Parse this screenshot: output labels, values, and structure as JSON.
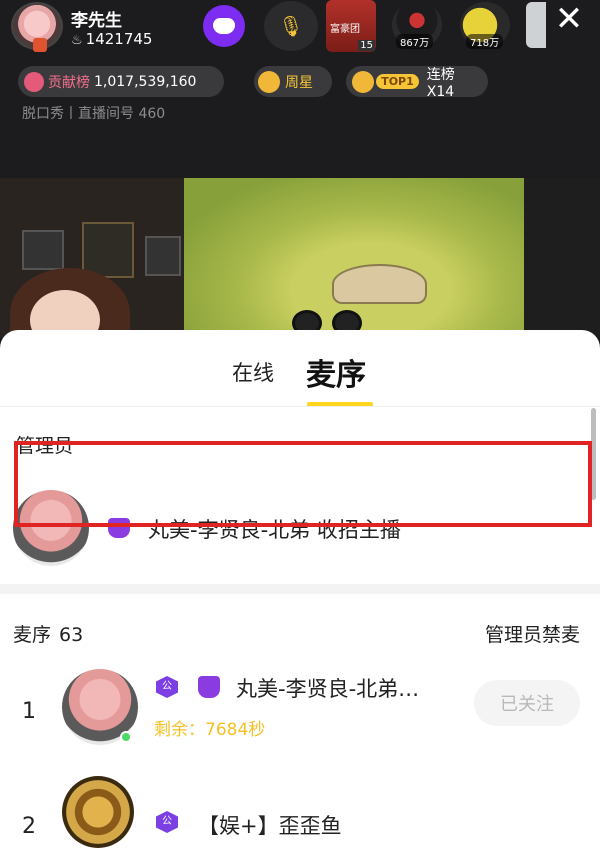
{
  "host": {
    "name": "李先生",
    "fans": "1421745"
  },
  "header": {
    "rank_badge": "富豪团",
    "rank_badge_num": "15",
    "fan_counts": [
      "867万",
      "718万"
    ],
    "contribution_label": "贡献榜",
    "contribution_value": "1,017,539,160",
    "week_star": "周星",
    "top_tag": "TOP1",
    "streak": "连榜X14",
    "room_meta": "脱口秀丨直播间号 460"
  },
  "tabs": {
    "online": "在线",
    "queue": "麦序"
  },
  "admins": {
    "title": "管理员",
    "items": [
      {
        "name": "丸美-李贤良-北弟 收招主播"
      }
    ]
  },
  "queue": {
    "title": "麦序",
    "count": "63",
    "ban_label": "管理员禁麦",
    "items": [
      {
        "index": "1",
        "badge": "公",
        "name": "丸美-李贤良-北弟…",
        "remain": "剩余：7684秒",
        "follow_state": "已关注"
      },
      {
        "index": "2",
        "badge": "公",
        "name": "【娱+】歪歪鱼"
      }
    ]
  },
  "colors": {
    "accent_yellow": "#ffd51e",
    "purple_badge": "#7b3fe4",
    "highlight_red": "#e02424"
  }
}
